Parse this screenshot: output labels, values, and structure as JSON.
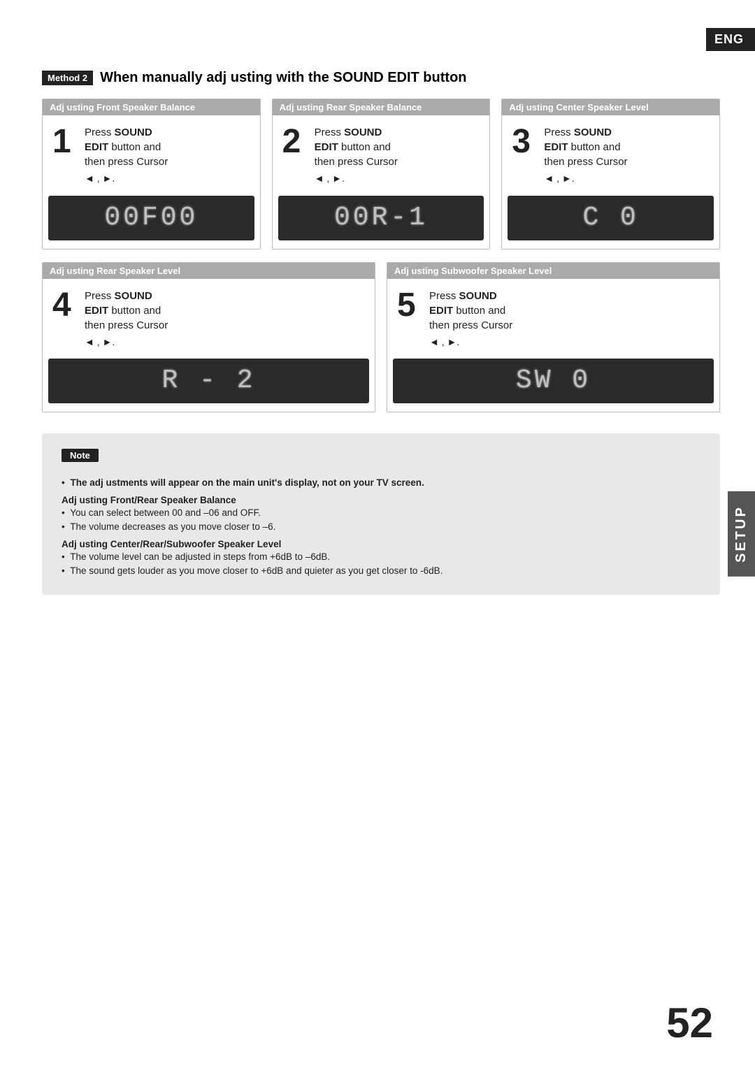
{
  "page": {
    "eng_label": "ENG",
    "setup_label": "SETUP",
    "page_number": "52"
  },
  "method_heading": {
    "badge": "Method 2",
    "title": "When manually adj usting with the SOUND EDIT button"
  },
  "cards": [
    {
      "id": "card1",
      "header": "Adj usting Front Speaker Balance",
      "step": "1",
      "line1": "Press ",
      "bold1": "SOUND",
      "line2": "EDIT",
      "line3": " button and",
      "line4": "then press Cursor",
      "cursor": "◄ , ►.",
      "display": "00F00"
    },
    {
      "id": "card2",
      "header": "Adj usting Rear Speaker Balance",
      "step": "2",
      "line1": "Press ",
      "bold1": "SOUND",
      "line2": "EDIT",
      "line3": " button and",
      "line4": "then press Cursor",
      "cursor": "◄ , ►.",
      "display": "00R-1"
    },
    {
      "id": "card3",
      "header": "Adj usting Center Speaker Level",
      "step": "3",
      "line1": "Press ",
      "bold1": "SOUND",
      "line2": "EDIT",
      "line3": " button and",
      "line4": "then press Cursor",
      "cursor": "◄ , ►.",
      "display": "C    0"
    },
    {
      "id": "card4",
      "header": "Adj usting Rear Speaker Level",
      "step": "4",
      "line1": "Press ",
      "bold1": "SOUND",
      "line2": "EDIT",
      "line3": " button and",
      "line4": "then press Cursor",
      "cursor": "◄ , ►.",
      "display": "R - 2"
    },
    {
      "id": "card5",
      "header": "Adj usting Subwoofer Speaker Level",
      "step": "5",
      "line1": "Press ",
      "bold1": "SOUND",
      "line2": "EDIT",
      "line3": " button and",
      "line4": "then press Cursor",
      "cursor": "◄ , ►.",
      "display": "SW  0"
    }
  ],
  "note": {
    "title": "Note",
    "main_note": "The adj ustments will appear on the main unit's display, not on your TV screen.",
    "section1_title": "Adj usting Front/Rear Speaker Balance",
    "section1_bullets": [
      "You can select between 00 and –06 and OFF.",
      "The volume decreases as you move closer to –6."
    ],
    "section2_title": "Adj usting Center/Rear/Subwoofer Speaker Level",
    "section2_bullets": [
      "The volume level can be adjusted in steps from +6dB to –6dB.",
      "The sound gets louder as you move closer to +6dB and quieter as you get closer to -6dB."
    ]
  }
}
